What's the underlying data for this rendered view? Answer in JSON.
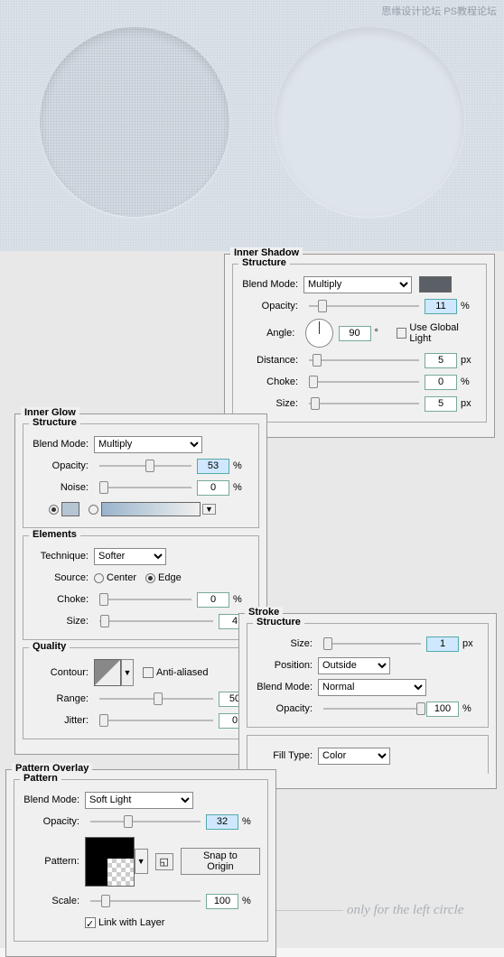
{
  "watermark": "思缘设计论坛  PS教程论坛",
  "inner_shadow": {
    "title": "Inner Shadow",
    "structure": {
      "title": "Structure",
      "blend_mode_lbl": "Blend Mode:",
      "blend_mode": "Multiply",
      "color": "#5a6066",
      "opacity_lbl": "Opacity:",
      "opacity": "11",
      "angle_lbl": "Angle:",
      "angle": "90",
      "angle_deg": "°",
      "global_lbl": "Use Global Light",
      "distance_lbl": "Distance:",
      "distance": "5",
      "distance_unit": "px",
      "choke_lbl": "Choke:",
      "choke": "0",
      "choke_unit": "%",
      "size_lbl": "Size:",
      "size": "5",
      "size_unit": "px"
    }
  },
  "inner_glow": {
    "title": "Inner Glow",
    "structure": {
      "title": "Structure",
      "blend_mode_lbl": "Blend Mode:",
      "blend_mode": "Multiply",
      "opacity_lbl": "Opacity:",
      "opacity": "53",
      "noise_lbl": "Noise:",
      "noise": "0",
      "color": "#b6c5d4"
    },
    "elements": {
      "title": "Elements",
      "technique_lbl": "Technique:",
      "technique": "Softer",
      "source_lbl": "Source:",
      "center": "Center",
      "edge": "Edge",
      "choke_lbl": "Choke:",
      "choke": "0",
      "size_lbl": "Size:",
      "size": "4"
    },
    "quality": {
      "title": "Quality",
      "contour_lbl": "Contour:",
      "aa_lbl": "Anti-aliased",
      "range_lbl": "Range:",
      "range": "50",
      "jitter_lbl": "Jitter:",
      "jitter": "0"
    }
  },
  "stroke": {
    "title": "Stroke",
    "structure": {
      "title": "Structure",
      "size_lbl": "Size:",
      "size": "1",
      "size_unit": "px",
      "position_lbl": "Position:",
      "position": "Outside",
      "blend_mode_lbl": "Blend Mode:",
      "blend_mode": "Normal",
      "opacity_lbl": "Opacity:",
      "opacity": "100"
    },
    "fill_type_lbl": "Fill Type:",
    "fill_type": "Color"
  },
  "pattern_overlay": {
    "title": "Pattern Overlay",
    "pattern": {
      "title": "Pattern",
      "blend_mode_lbl": "Blend Mode:",
      "blend_mode": "Soft Light",
      "opacity_lbl": "Opacity:",
      "opacity": "32",
      "pattern_lbl": "Pattern:",
      "snap_lbl": "Snap to Origin",
      "scale_lbl": "Scale:",
      "scale": "100",
      "link_lbl": "Link with Layer"
    }
  },
  "note": "only for the left circle"
}
